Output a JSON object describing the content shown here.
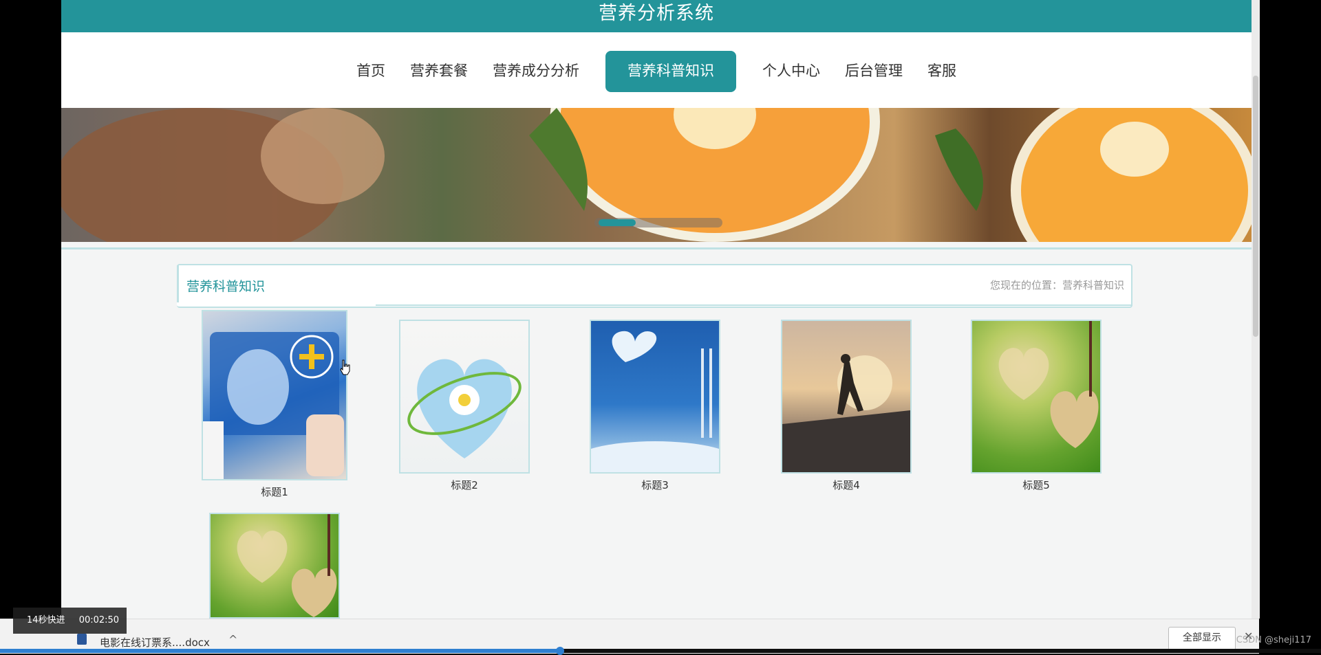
{
  "app": {
    "title": "营养分析系统"
  },
  "nav": {
    "items": [
      {
        "label": "首页"
      },
      {
        "label": "营养套餐"
      },
      {
        "label": "营养成分分析"
      },
      {
        "label": "营养科普知识",
        "active": true
      },
      {
        "label": "个人中心"
      },
      {
        "label": "后台管理"
      },
      {
        "label": "客服"
      }
    ]
  },
  "banner": {
    "active_slide": 1
  },
  "section": {
    "title": "营养科普知识",
    "location": "您现在的位置：营养科普知识"
  },
  "cards": [
    {
      "caption": "标题1"
    },
    {
      "caption": "标题2"
    },
    {
      "caption": "标题3"
    },
    {
      "caption": "标题4"
    },
    {
      "caption": "标题5"
    },
    {
      "caption": ""
    }
  ],
  "downloads": {
    "file_name": "电影在线订票系....docx",
    "show_all_label": "全部显示"
  },
  "video_overlay": {
    "speed_label": "14秒快进",
    "time": "00:02:50"
  },
  "watermark": "CSDN @sheji117",
  "colors": {
    "accent": "#23949a",
    "border": "#bfe1e4",
    "progress": "#2f7fd0"
  }
}
